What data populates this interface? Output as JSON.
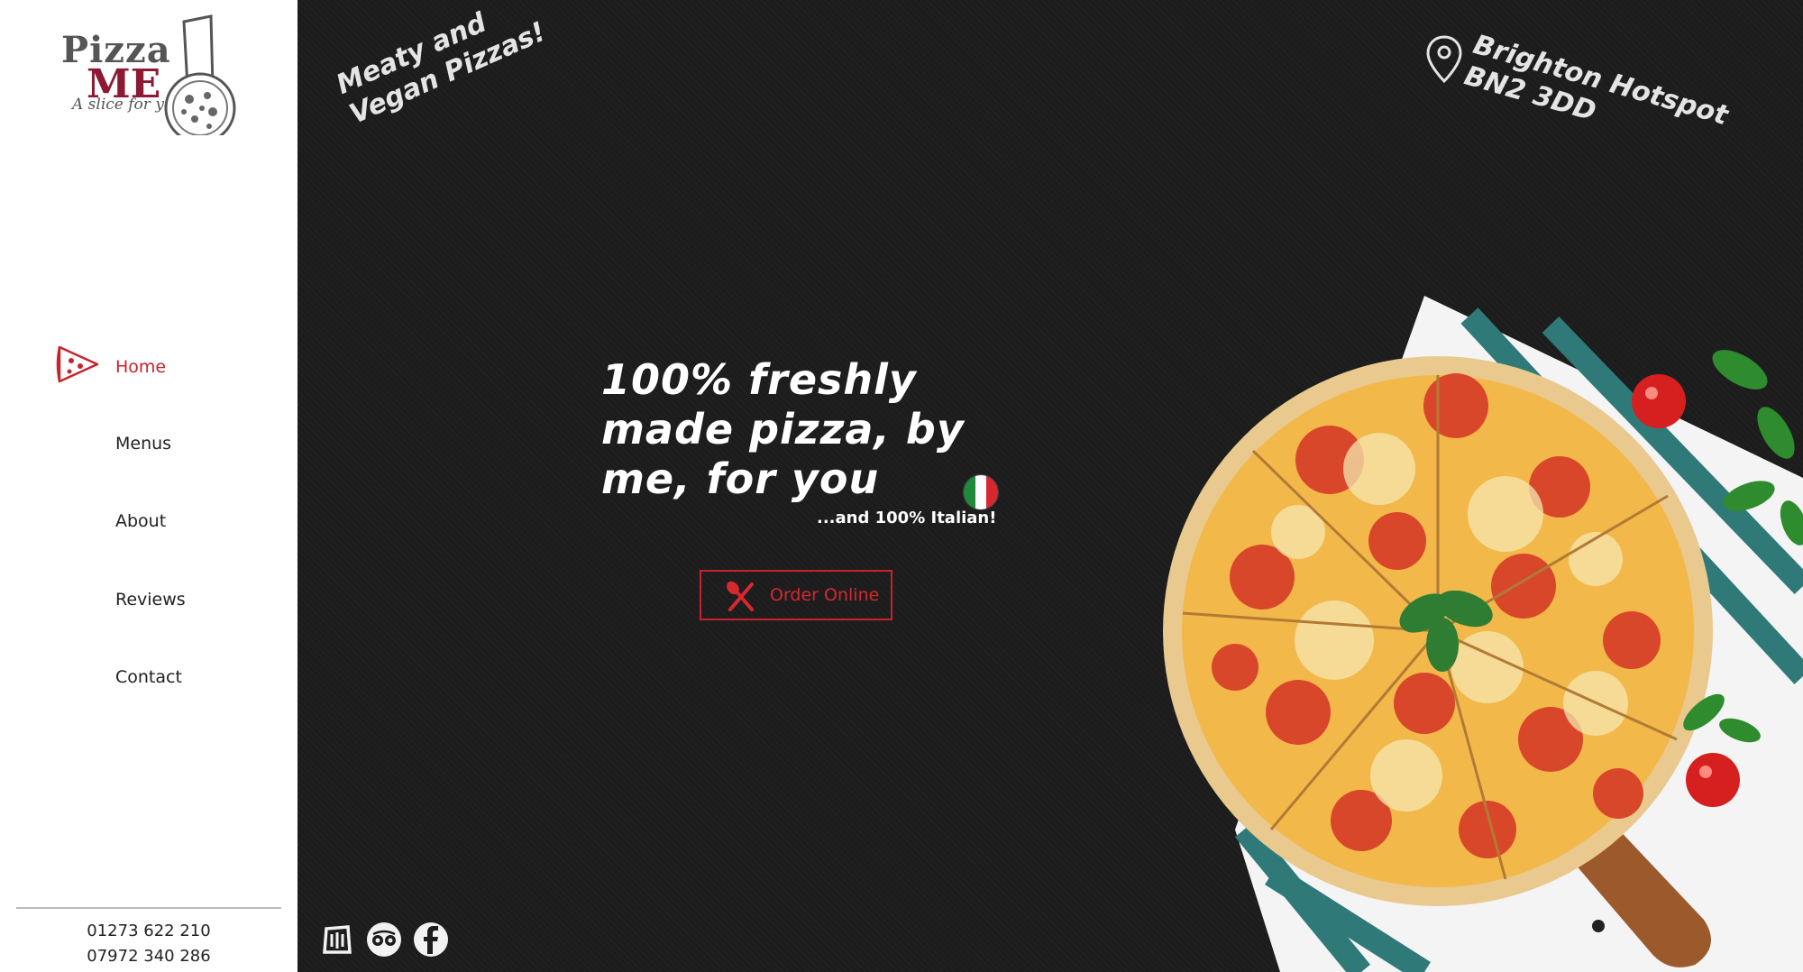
{
  "logo": {
    "line1": "Pizza",
    "line2": "ME",
    "tagline": "A slice for you"
  },
  "nav": {
    "items": [
      {
        "label": "Home",
        "active": true
      },
      {
        "label": "Menus",
        "active": false
      },
      {
        "label": "About",
        "active": false
      },
      {
        "label": "Reviews",
        "active": false
      },
      {
        "label": "Contact",
        "active": false
      }
    ]
  },
  "contact": {
    "phone1": "01273 622 210",
    "phone2": "07972 340 286"
  },
  "hero": {
    "tagline": "Meaty and Vegan Pizzas!",
    "location": "Brighton Hotspot BN2 3DD",
    "headline": "100% freshly made pizza, by me, for you",
    "subline": "...and 100% Italian!",
    "order_label": "Order Online"
  },
  "socials": [
    {
      "icon": "deliveroo-icon"
    },
    {
      "icon": "tripadvisor-icon"
    },
    {
      "icon": "facebook-icon"
    }
  ],
  "colors": {
    "accent": "#c8232c",
    "brand_maroon": "#8c1a34",
    "hero_bg": "#1c1c1c"
  }
}
